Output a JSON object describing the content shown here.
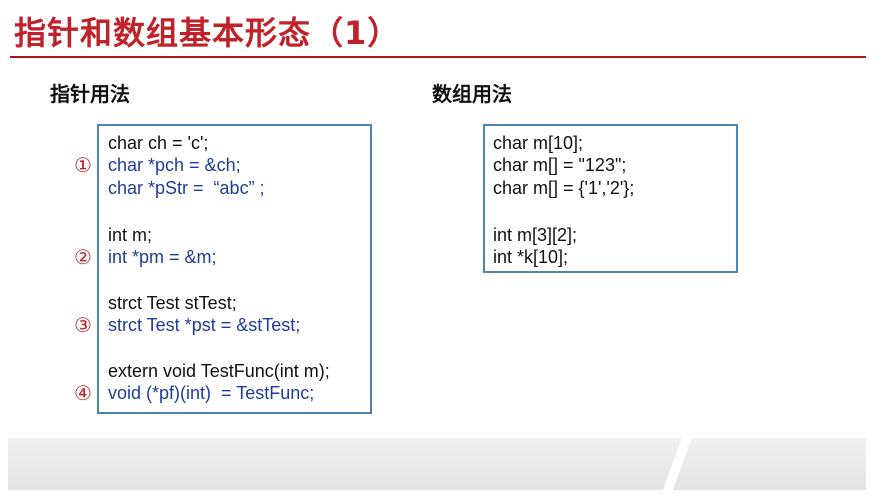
{
  "title": "指针和数组基本形态（1）",
  "sections": {
    "pointer_label": "指针用法",
    "array_label": "数组用法"
  },
  "pointer_code": [
    {
      "text": "char ch = 'c';",
      "color": "black"
    },
    {
      "text": "char *pch = &ch;",
      "color": "blue"
    },
    {
      "text": "char *pStr =  “abc” ;",
      "color": "blue"
    },
    {
      "text": "int m;",
      "color": "black"
    },
    {
      "text": "int *pm = &m;",
      "color": "blue"
    },
    {
      "text": "strct Test stTest;",
      "color": "black"
    },
    {
      "text": "strct Test *pst = &stTest;",
      "color": "blue"
    },
    {
      "text": "extern void TestFunc(int m);",
      "color": "black"
    },
    {
      "text": "void (*pf)(int)  = TestFunc;",
      "color": "blue"
    }
  ],
  "markers": [
    "①",
    "②",
    "③",
    "④"
  ],
  "array_code": [
    {
      "text": "char m[10];"
    },
    {
      "text": "char m[] = \"123\";"
    },
    {
      "text": "char m[] = {'1','2'};"
    },
    {
      "text": "int m[3][2];"
    },
    {
      "text": "int *k[10];"
    }
  ],
  "colors": {
    "title": "#c0222a",
    "rule": "#a5151b",
    "box_border": "#4d84b8",
    "code_blue": "#1f3c9c",
    "marker": "#c0222a"
  }
}
